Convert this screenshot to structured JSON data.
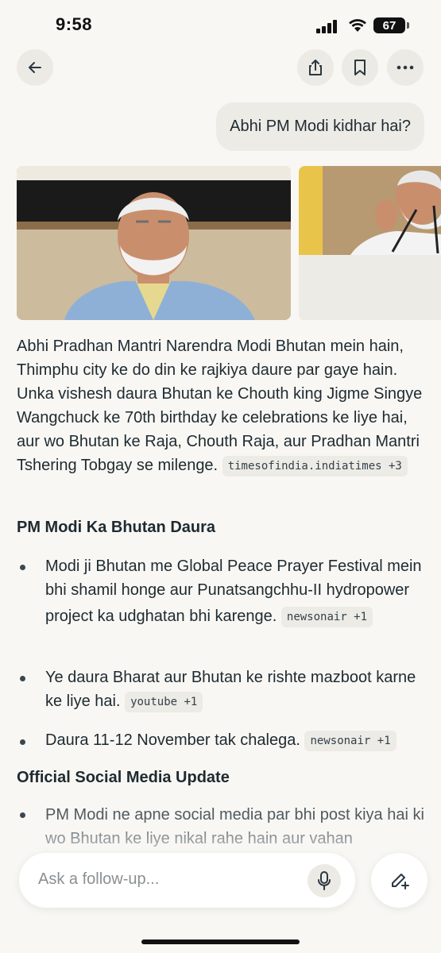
{
  "status": {
    "time": "9:58",
    "battery": "67"
  },
  "nav": {
    "back_icon": "arrow-left-icon",
    "share_icon": "share-icon",
    "bookmark_icon": "bookmark-icon",
    "more_icon": "more-horizontal-icon"
  },
  "user_query": "Abhi PM Modi kidhar hai?",
  "answer": {
    "paragraph": "Abhi Pradhan Mantri Narendra Modi Bhutan mein hain, Thimphu city ke do din ke rajkiya daure par gaye hain. Unka vishesh daura Bhutan ke Chouth king Jigme Singye Wangchuck ke 70th birthday ke celebrations ke liye hai, aur wo Bhutan ke Raja, Chouth Raja, aur Pradhan Mantri Tshering Tobgay se milenge.",
    "paragraph_cite": "timesofindia.indiatimes +3",
    "section1_heading": "PM Modi Ka Bhutan Daura",
    "bullets1": [
      {
        "text": "Modi ji Bhutan me Global Peace Prayer Festival mein bhi shamil honge aur Punatsangchhu-II hydropower project ka udghatan bhi karenge.",
        "cite": "newsonair +1"
      },
      {
        "text": "Ye daura Bharat aur Bhutan ke rishte mazboot karne ke liye hai.",
        "cite": "youtube +1"
      },
      {
        "text": "Daura 11-12 November tak chalega.",
        "cite": "newsonair +1"
      }
    ],
    "section2_heading": "Official Social Media Update",
    "bullets2": [
      {
        "text": "PM Modi ne apne social media par bhi post kiya hai ki wo Bhutan ke liye nikal rahe hain aur vahan"
      }
    ]
  },
  "followup": {
    "placeholder": "Ask a follow-up...",
    "mic_icon": "microphone-icon",
    "new_icon": "new-chat-icon"
  },
  "colors": {
    "background": "#f8f7f3",
    "text": "#1e2a31",
    "chip": "#ecebe6"
  }
}
